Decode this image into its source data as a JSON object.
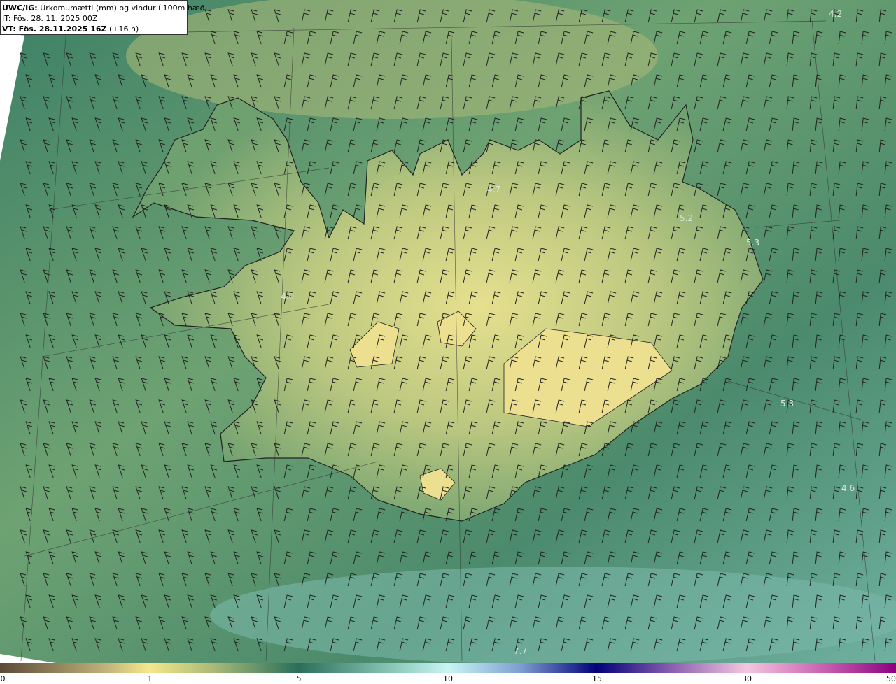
{
  "header": {
    "product_label": "UWC/IG:",
    "product_desc": "Úrkomumætti (mm) og vindur í 100m hæð",
    "init_time": "IT: Fös. 28. 11. 2025 00Z",
    "valid_label": "VT: Fös. 28.11.2025 16Z",
    "valid_offset": "(+16 h)"
  },
  "map_labels": [
    "4.2",
    "4.7",
    "5.2",
    "5.3",
    "4.0",
    "5.3",
    "4.6",
    "7.7"
  ],
  "colorbar": {
    "ticks": [
      "0",
      "1",
      "5",
      "10",
      "15",
      "30",
      "50"
    ],
    "colors": [
      "#5b4a38",
      "#f5e88c",
      "#2a6e5a",
      "#c8f6f4",
      "#02007a",
      "#f5c6e0",
      "#8d0080"
    ]
  }
}
